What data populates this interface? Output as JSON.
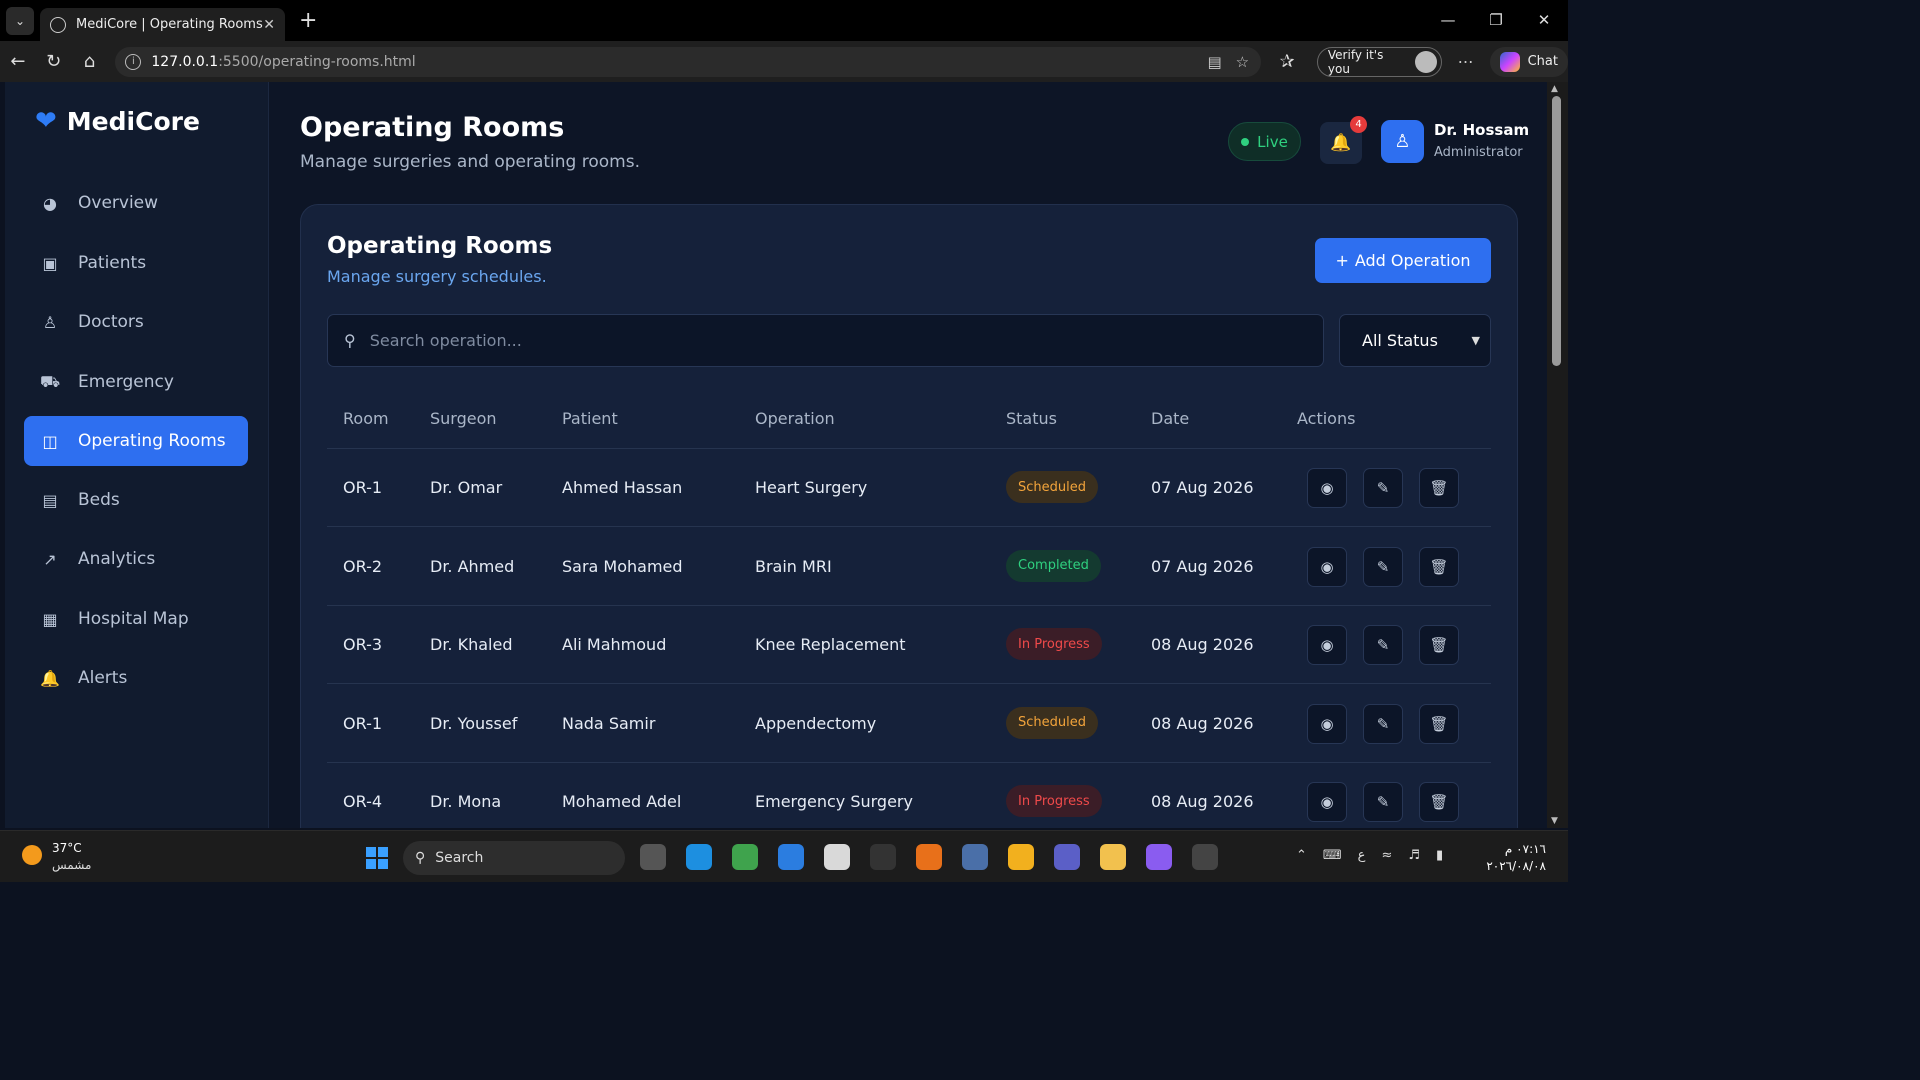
{
  "browser": {
    "tab_title": "MediCore | Operating Rooms",
    "url_host": "127.0.0.1",
    "url_path": ":5500/operating-rooms.html",
    "verify_label": "Verify it's you",
    "chat_label": "Chat"
  },
  "sidebar": {
    "brand": "MediCore",
    "items": [
      {
        "label": "Overview",
        "icon": "pie-chart-icon"
      },
      {
        "label": "Patients",
        "icon": "patients-icon"
      },
      {
        "label": "Doctors",
        "icon": "doctor-icon"
      },
      {
        "label": "Emergency",
        "icon": "ambulance-icon"
      },
      {
        "label": "Operating Rooms",
        "icon": "bed-pulse-icon",
        "active": true
      },
      {
        "label": "Beds",
        "icon": "bed-icon"
      },
      {
        "label": "Analytics",
        "icon": "line-chart-icon"
      },
      {
        "label": "Hospital Map",
        "icon": "map-icon"
      },
      {
        "label": "Alerts",
        "icon": "bell-icon"
      }
    ]
  },
  "header": {
    "title": "Operating Rooms",
    "subtitle": "Manage surgeries and operating rooms.",
    "live_label": "Live",
    "notification_count": "4",
    "user_name": "Dr. Hossam",
    "user_role": "Administrator"
  },
  "card": {
    "title": "Operating Rooms",
    "subtitle": "Manage surgery schedules.",
    "add_button": "Add Operation",
    "search_placeholder": "Search operation...",
    "status_filter": "All Status",
    "columns": [
      "Room",
      "Surgeon",
      "Patient",
      "Operation",
      "Status",
      "Date",
      "Actions"
    ],
    "rows": [
      {
        "room": "OR-1",
        "surgeon": "Dr. Omar",
        "patient": "Ahmed Hassan",
        "operation": "Heart Surgery",
        "status": "Scheduled",
        "date": "07 Aug 2026"
      },
      {
        "room": "OR-2",
        "surgeon": "Dr. Ahmed",
        "patient": "Sara Mohamed",
        "operation": "Brain MRI",
        "status": "Completed",
        "date": "07 Aug 2026"
      },
      {
        "room": "OR-3",
        "surgeon": "Dr. Khaled",
        "patient": "Ali Mahmoud",
        "operation": "Knee Replacement",
        "status": "In Progress",
        "date": "08 Aug 2026"
      },
      {
        "room": "OR-1",
        "surgeon": "Dr. Youssef",
        "patient": "Nada Samir",
        "operation": "Appendectomy",
        "status": "Scheduled",
        "date": "08 Aug 2026"
      },
      {
        "room": "OR-4",
        "surgeon": "Dr. Mona",
        "patient": "Mohamed Adel",
        "operation": "Emergency Surgery",
        "status": "In Progress",
        "date": "08 Aug 2026"
      }
    ]
  },
  "taskbar": {
    "temperature": "37°C",
    "condition": "مشمس",
    "search_label": "Search",
    "time": "٠٧:١٦ م",
    "date": "٢٠٢٦/٠٨/٠٨"
  },
  "colors": {
    "accent": "#2e6ff0",
    "scheduled": "#f3a43b",
    "completed": "#2fd07f",
    "in_progress": "#ef4a4a"
  }
}
